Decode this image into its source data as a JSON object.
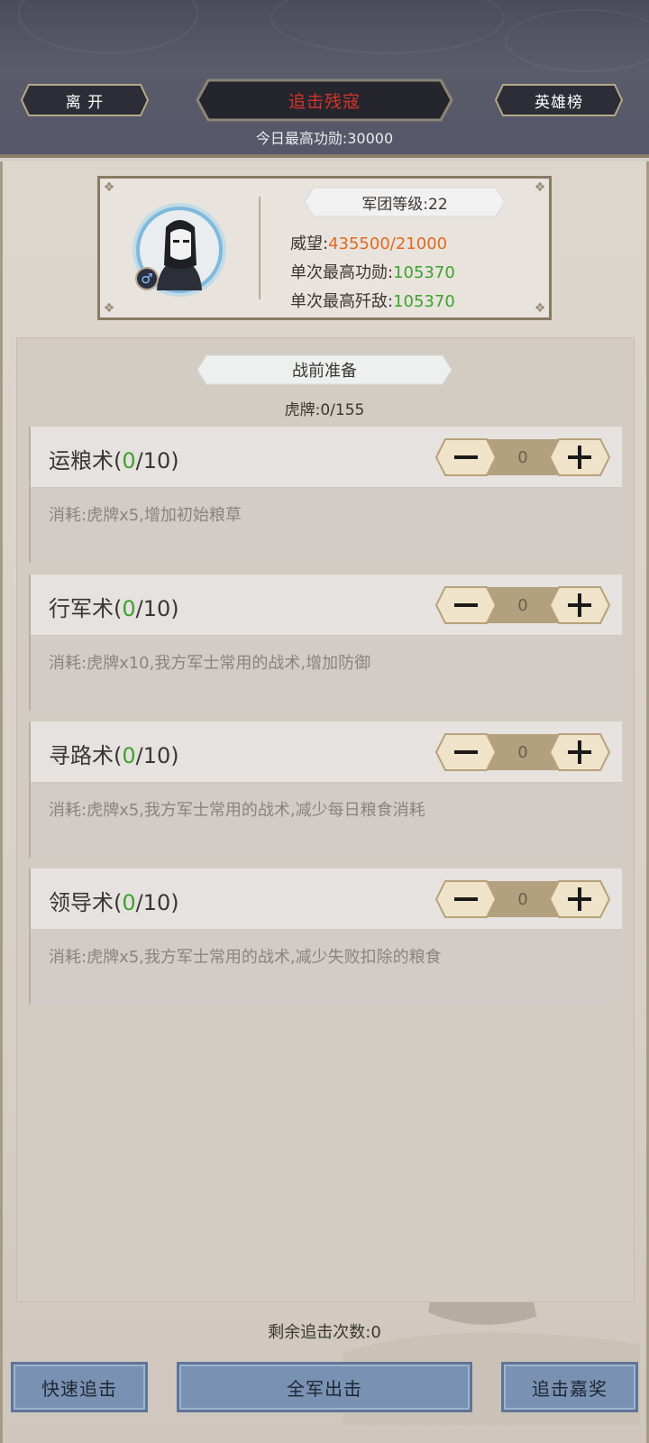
{
  "header": {
    "leave_label": "离 开",
    "title": "追击残寇",
    "hero_board_label": "英雄榜",
    "today_best_label": "今日最高功勋:",
    "today_best_value": "30000"
  },
  "profile": {
    "gender_icon": "male-icon",
    "legion_level_label": "军团等级:",
    "legion_level_value": "22",
    "prestige_label": "威望:",
    "prestige_value": "435500/21000",
    "best_merit_label": "单次最高功勋:",
    "best_merit_value": "105370",
    "best_kills_label": "单次最高歼敌:",
    "best_kills_value": "105370"
  },
  "prep": {
    "title": "战前准备",
    "tiger_label": "虎牌:",
    "tiger_value": "0/155",
    "skills": [
      {
        "name": "运粮术",
        "open": "(",
        "current": "0",
        "max": "/10)",
        "value": "0",
        "desc": "消耗:虎牌x5,增加初始粮草"
      },
      {
        "name": "行军术",
        "open": "(",
        "current": "0",
        "max": "/10)",
        "value": "0",
        "desc": "消耗:虎牌x10,我方军士常用的战术,增加防御"
      },
      {
        "name": "寻路术",
        "open": "(",
        "current": "0",
        "max": "/10)",
        "value": "0",
        "desc": "消耗:虎牌x5,我方军士常用的战术,减少每日粮食消耗"
      },
      {
        "name": "领导术",
        "open": "(",
        "current": "0",
        "max": "/10)",
        "value": "0",
        "desc": "消耗:虎牌x5,我方军士常用的战术,减少失败扣除的粮食"
      }
    ]
  },
  "footer": {
    "remain_label": "剩余追击次数:",
    "remain_value": "0",
    "quick_label": "快速追击",
    "all_label": "全军出击",
    "reward_label": "追击嘉奖"
  },
  "colors": {
    "accent_red": "#d4352a",
    "value_orange": "#e06a22",
    "value_green": "#3ea22c",
    "button_blue": "#7991b2"
  }
}
